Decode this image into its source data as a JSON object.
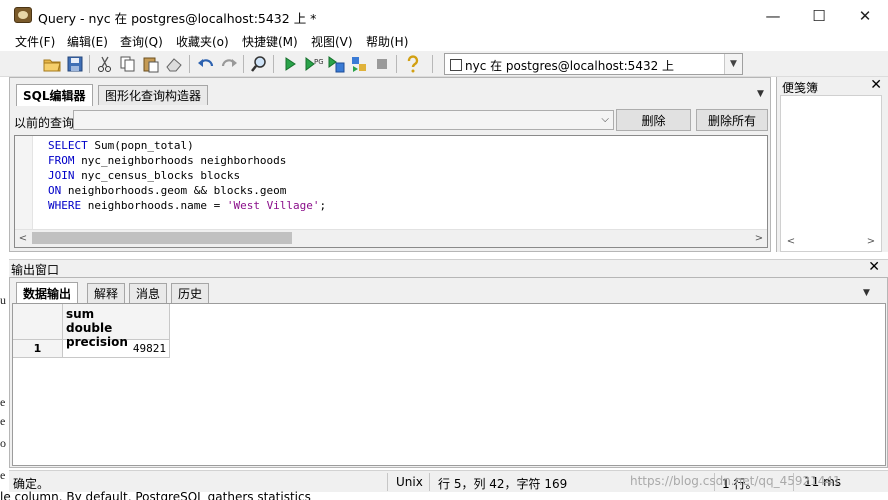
{
  "window": {
    "title": "Query - nyc 在  postgres@localhost:5432 上 *",
    "minimize": "—",
    "maximize": "☐",
    "close": "✕"
  },
  "menu": [
    "文件(F)",
    "编辑(E)",
    "查询(Q)",
    "收藏夹(o)",
    "快捷键(M)",
    "视图(V)",
    "帮助(H)"
  ],
  "toolbar": {
    "connection": "nyc 在  postgres@localhost:5432 上",
    "icons": [
      "open-folder-icon",
      "save-icon",
      "cut-icon",
      "copy-icon",
      "paste-icon",
      "eraser-icon",
      "undo-icon",
      "redo-icon",
      "find-icon",
      "execute-icon",
      "explain-icon",
      "execute-to-file-icon",
      "pgscript-icon",
      "stop-icon",
      "help-icon"
    ]
  },
  "editor": {
    "tabs": [
      "SQL编辑器",
      "图形化查询构造器"
    ],
    "previous_label": "以前的查询",
    "delete": "删除",
    "delete_all": "删除所有",
    "code": [
      {
        "kw": "SELECT",
        "rest": " Sum(popn_total)"
      },
      {
        "kw": "FROM",
        "rest": " nyc_neighborhoods neighborhoods"
      },
      {
        "kw": "JOIN",
        "rest": " nyc_census_blocks blocks"
      },
      {
        "kw": "ON",
        "rest": " neighborhoods.geom && blocks.geom"
      },
      {
        "kw": "WHERE",
        "rest": " neighborhoods.name = ",
        "str": "'West Village'",
        "tail": ";"
      }
    ]
  },
  "scratch": {
    "title": "便笺簿"
  },
  "output": {
    "title": "输出窗口",
    "tabs": [
      "数据输出",
      "解释",
      "消息",
      "历史"
    ],
    "columns": [
      {
        "name": "sum",
        "type": "double precision"
      }
    ],
    "rows": [
      {
        "num": "1",
        "value": "49821"
      }
    ]
  },
  "background_fragments": [
    "u",
    "e",
    "e",
    "o",
    "e"
  ],
  "status": {
    "message": "确定。",
    "line_ending": "Unix",
    "position": "行 5，列 42，字符 169",
    "rows": "1 行。",
    "time": "11 ms"
  },
  "watermark": "https://blog.csdn.net/qq_45921441",
  "bottom_text": "le column. By default, PostgreSQL gathers statistics"
}
